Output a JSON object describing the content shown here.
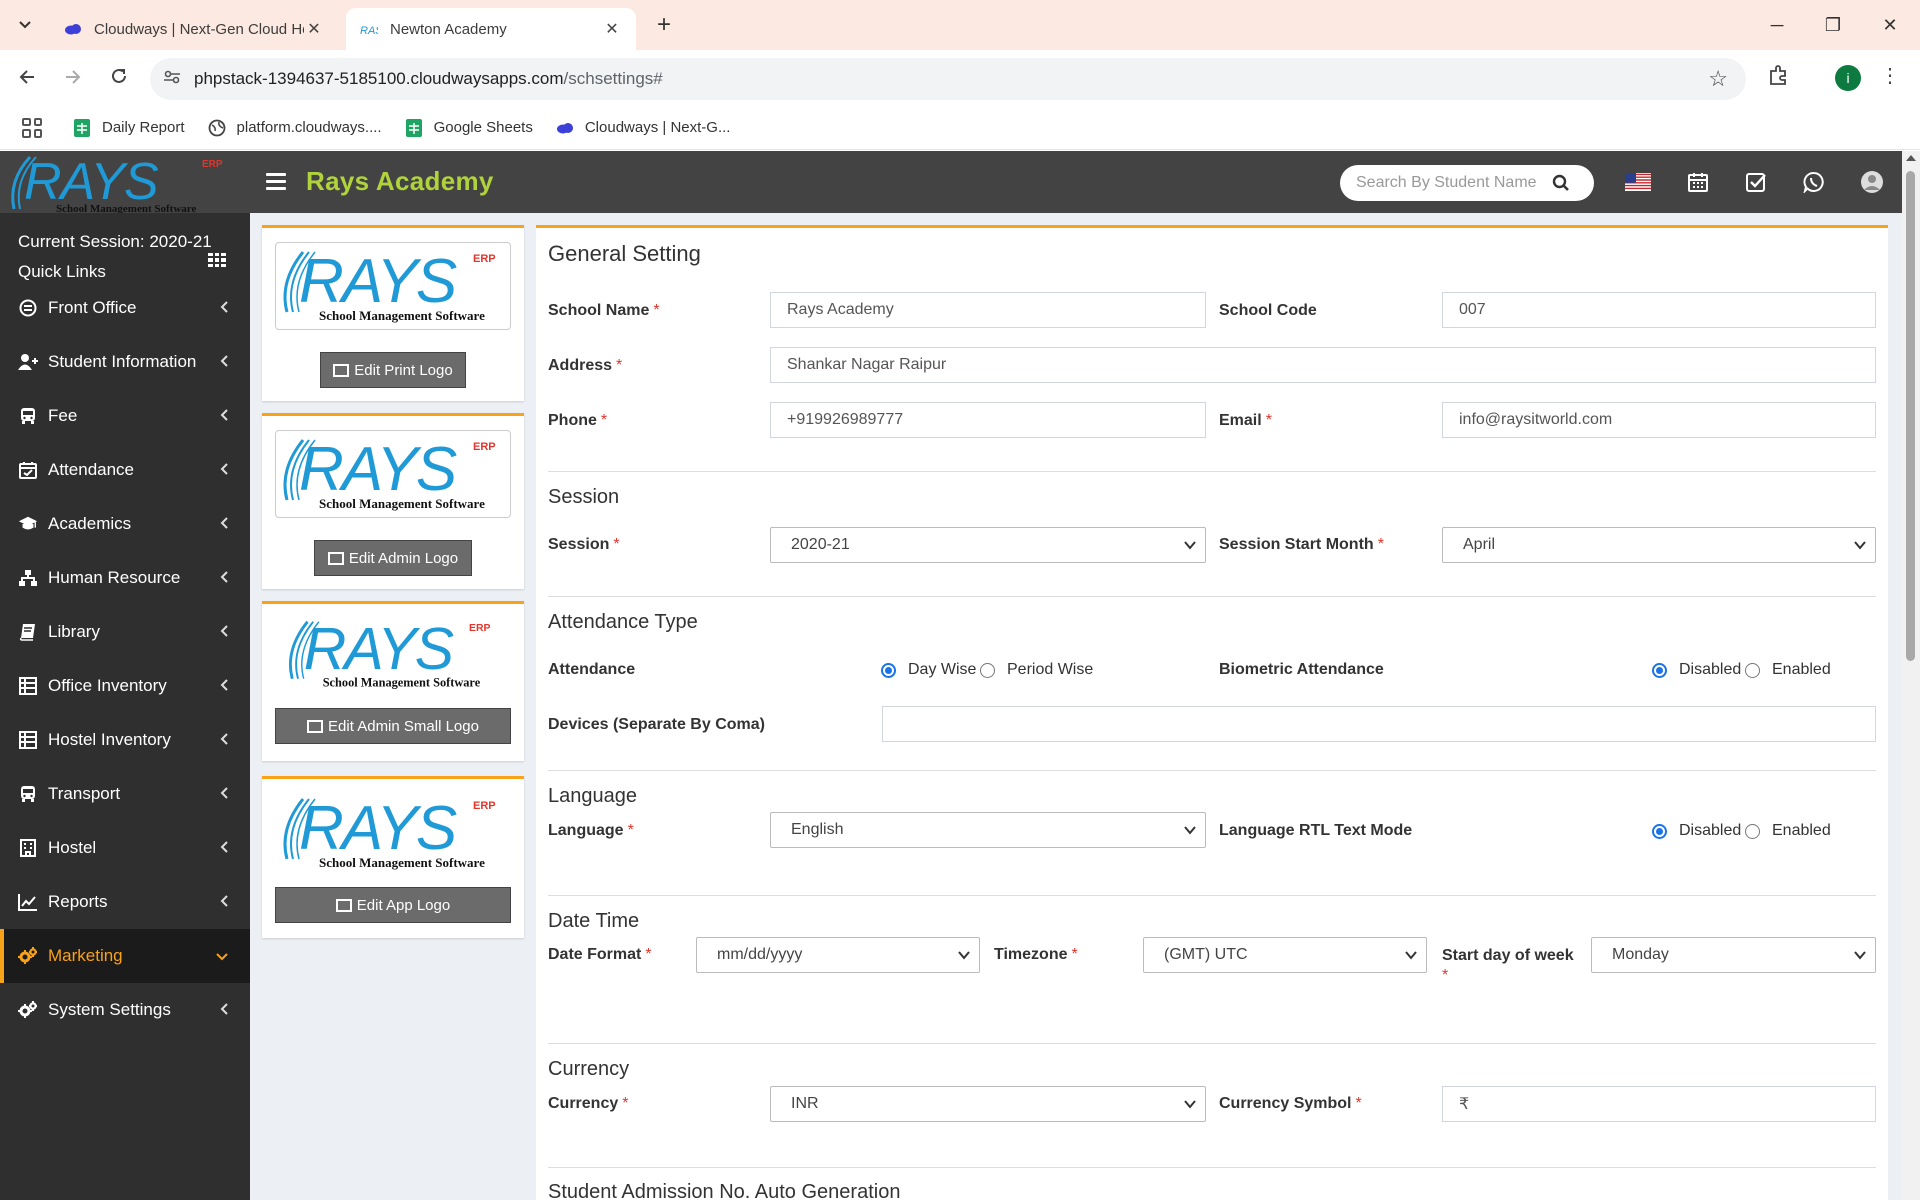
{
  "browser": {
    "tabs": [
      {
        "title": "Cloudways | Next-Gen Cloud Hosting",
        "active": false
      },
      {
        "title": "Newton Academy",
        "active": true
      }
    ],
    "url_host": "phpstack-1394637-5185100.cloudwaysapps.com",
    "url_path": "/schsettings#",
    "profile_initial": "i",
    "bookmarks": [
      "Daily Report",
      "platform.cloudways....",
      "Google Sheets",
      "Cloudways | Next-G..."
    ]
  },
  "header": {
    "app_title": "Rays Academy",
    "search_placeholder": "Search By Student Name",
    "logo_text": "RAYS",
    "logo_tag": "ERP",
    "logo_sub": "School Management Software"
  },
  "sidebar": {
    "current_session": "Current Session: 2020-21",
    "quick_links": "Quick Links",
    "items": [
      {
        "label": "Front Office",
        "icon": "front-office-icon"
      },
      {
        "label": "Student Information",
        "icon": "student-icon"
      },
      {
        "label": "Fee",
        "icon": "bus-icon"
      },
      {
        "label": "Attendance",
        "icon": "calendar-check-icon"
      },
      {
        "label": "Academics",
        "icon": "graduation-cap-icon"
      },
      {
        "label": "Human Resource",
        "icon": "sitemap-icon"
      },
      {
        "label": "Library",
        "icon": "book-icon"
      },
      {
        "label": "Office Inventory",
        "icon": "inventory-icon"
      },
      {
        "label": "Hostel Inventory",
        "icon": "inventory-icon"
      },
      {
        "label": "Transport",
        "icon": "bus-icon"
      },
      {
        "label": "Hostel",
        "icon": "building-icon"
      },
      {
        "label": "Reports",
        "icon": "line-chart-icon"
      },
      {
        "label": "Marketing",
        "icon": "gears-icon",
        "active": true
      },
      {
        "label": "System Settings",
        "icon": "gears-icon"
      }
    ]
  },
  "logos": {
    "edit_print": "Edit Print Logo",
    "edit_admin": "Edit Admin Logo",
    "edit_admin_small": "Edit Admin Small Logo",
    "edit_app": "Edit App Logo"
  },
  "general": {
    "title": "General Setting",
    "school_name_label": "School Name",
    "school_name": "Rays Academy",
    "school_code_label": "School Code",
    "school_code": "007",
    "address_label": "Address",
    "address": "Shankar Nagar Raipur",
    "phone_label": "Phone",
    "phone": "+919926989777",
    "email_label": "Email",
    "email": "info@raysitworld.com"
  },
  "session": {
    "title": "Session",
    "session_label": "Session",
    "session_value": "2020-21",
    "start_month_label": "Session Start Month",
    "start_month_value": "April"
  },
  "attendance": {
    "title": "Attendance Type",
    "attendance_label": "Attendance",
    "day_wise": "Day Wise",
    "period_wise": "Period Wise",
    "selected": "Day Wise",
    "biometric_label": "Biometric Attendance",
    "disabled": "Disabled",
    "enabled": "Enabled",
    "biometric_selected": "Disabled",
    "devices_label": "Devices (Separate By Coma)",
    "devices_value": ""
  },
  "language": {
    "title": "Language",
    "language_label": "Language",
    "language_value": "English",
    "rtl_label": "Language RTL Text Mode",
    "disabled": "Disabled",
    "enabled": "Enabled",
    "rtl_selected": "Disabled"
  },
  "datetime": {
    "title": "Date Time",
    "date_format_label": "Date Format",
    "date_format_value": "mm/dd/yyyy",
    "timezone_label": "Timezone",
    "timezone_value": "(GMT) UTC",
    "start_day_label": "Start day of week",
    "start_day_value": "Monday"
  },
  "currency": {
    "title": "Currency",
    "currency_label": "Currency",
    "currency_value": "INR",
    "symbol_label": "Currency Symbol",
    "symbol_value": "₹"
  },
  "admission": {
    "title": "Student Admission No. Auto Generation"
  },
  "colors": {
    "accent": "#f8a21a",
    "title_green": "#b0d33c",
    "header_bg": "#434343",
    "sidebar_bg": "#2f2f2f",
    "logo_blue": "#1f9ad6"
  }
}
